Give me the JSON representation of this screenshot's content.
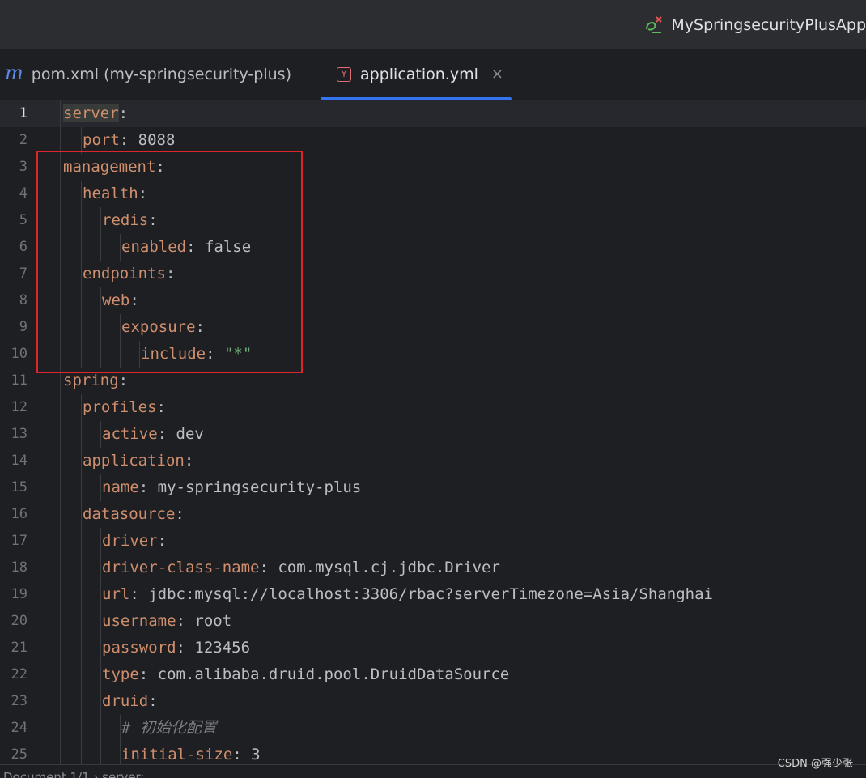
{
  "titlebar": {
    "run_config_label": "MySpringsecurityPlusApp"
  },
  "tabs": [
    {
      "icon": "maven-icon",
      "icon_glyph": "m",
      "label": "pom.xml (my-springsecurity-plus)",
      "active": false
    },
    {
      "icon": "yaml-file-icon",
      "icon_glyph": "Y",
      "label": "application.yml",
      "active": true,
      "close_glyph": "×"
    }
  ],
  "editor": {
    "lines": [
      {
        "n": "1",
        "indent": 0,
        "key": "server",
        "colon": ":",
        "value": ""
      },
      {
        "n": "2",
        "indent": 1,
        "key": "port",
        "colon": ":",
        "value": " 8088"
      },
      {
        "n": "3",
        "indent": 0,
        "key": "management",
        "colon": ":",
        "value": ""
      },
      {
        "n": "4",
        "indent": 1,
        "key": "health",
        "colon": ":",
        "value": ""
      },
      {
        "n": "5",
        "indent": 2,
        "key": "redis",
        "colon": ":",
        "value": ""
      },
      {
        "n": "6",
        "indent": 3,
        "key": "enabled",
        "colon": ":",
        "value": " false"
      },
      {
        "n": "7",
        "indent": 1,
        "key": "endpoints",
        "colon": ":",
        "value": ""
      },
      {
        "n": "8",
        "indent": 2,
        "key": "web",
        "colon": ":",
        "value": ""
      },
      {
        "n": "9",
        "indent": 3,
        "key": "exposure",
        "colon": ":",
        "value": ""
      },
      {
        "n": "10",
        "indent": 4,
        "key": "include",
        "colon": ":",
        "value": " ",
        "str": "\"*\""
      },
      {
        "n": "11",
        "indent": 0,
        "key": "spring",
        "colon": ":",
        "value": ""
      },
      {
        "n": "12",
        "indent": 1,
        "key": "profiles",
        "colon": ":",
        "value": ""
      },
      {
        "n": "13",
        "indent": 2,
        "key": "active",
        "colon": ":",
        "value": " dev"
      },
      {
        "n": "14",
        "indent": 1,
        "key": "application",
        "colon": ":",
        "value": ""
      },
      {
        "n": "15",
        "indent": 2,
        "key": "name",
        "colon": ":",
        "value": " my-springsecurity-plus"
      },
      {
        "n": "16",
        "indent": 1,
        "key": "datasource",
        "colon": ":",
        "value": ""
      },
      {
        "n": "17",
        "indent": 2,
        "key": "driver",
        "colon": ":",
        "value": ""
      },
      {
        "n": "18",
        "indent": 2,
        "key": "driver-class-name",
        "colon": ":",
        "value": " com.mysql.cj.jdbc.Driver"
      },
      {
        "n": "19",
        "indent": 2,
        "key": "url",
        "colon": ":",
        "value": " jdbc:mysql://localhost:3306/rbac?serverTimezone=Asia/Shanghai"
      },
      {
        "n": "20",
        "indent": 2,
        "key": "username",
        "colon": ":",
        "value": " root"
      },
      {
        "n": "21",
        "indent": 2,
        "key": "password",
        "colon": ":",
        "value": " 123456"
      },
      {
        "n": "22",
        "indent": 2,
        "key": "type",
        "colon": ":",
        "value": " com.alibaba.druid.pool.DruidDataSource"
      },
      {
        "n": "23",
        "indent": 2,
        "key": "druid",
        "colon": ":",
        "value": ""
      },
      {
        "n": "24",
        "indent": 3,
        "key": "",
        "colon": "",
        "value": "",
        "comment": "# 初始化配置"
      },
      {
        "n": "25",
        "indent": 3,
        "key": "initial-size",
        "colon": ":",
        "value": " 3"
      }
    ],
    "current_line": "1"
  },
  "statusbar": {
    "text": "Document 1/1  ›  server:"
  },
  "watermark": "CSDN @强少张",
  "colors": {
    "accent": "#3574f0",
    "key": "#cf8e6d",
    "string": "#6aab73",
    "annotation_box": "#e0242c"
  }
}
